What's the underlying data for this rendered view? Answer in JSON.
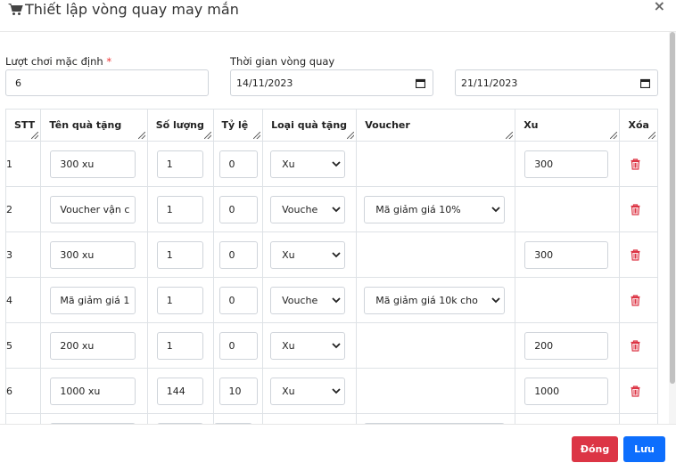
{
  "dialog": {
    "title": "Thiết lập vòng quay may mắn",
    "close_symbol": "×",
    "title_icon": "shopping-cart-icon"
  },
  "form": {
    "plays_label": "Lượt chơi mặc định",
    "plays_required_mark": "*",
    "plays_value": "6",
    "time_label": "Thời gian vòng quay",
    "start_date": "14/11/2023",
    "end_date": "21/11/2023"
  },
  "table": {
    "headers": [
      "STT",
      "Tên quà tặng",
      "Số lượng",
      "Tỷ lệ",
      "Loại quà tặng",
      "Voucher",
      "Xu",
      "Xóa"
    ],
    "rows": [
      {
        "stt": "1",
        "name": "300 xu",
        "qty": "1",
        "rate": "0",
        "type": "Xu",
        "voucher": "",
        "xu": "300"
      },
      {
        "stt": "2",
        "name": "Voucher vận c",
        "qty": "1",
        "rate": "0",
        "type": "Vouche",
        "voucher": "Mã giảm giá 10%",
        "xu": ""
      },
      {
        "stt": "3",
        "name": "300 xu",
        "qty": "1",
        "rate": "0",
        "type": "Xu",
        "voucher": "",
        "xu": "300"
      },
      {
        "stt": "4",
        "name": "Mã giảm giá 1",
        "qty": "1",
        "rate": "0",
        "type": "Vouche",
        "voucher": "Mã giảm giá 10k cho",
        "xu": ""
      },
      {
        "stt": "5",
        "name": "200 xu",
        "qty": "1",
        "rate": "0",
        "type": "Xu",
        "voucher": "",
        "xu": "200"
      },
      {
        "stt": "6",
        "name": "1000 xu",
        "qty": "144",
        "rate": "10",
        "type": "Xu",
        "voucher": "",
        "xu": "1000"
      }
    ],
    "delete_icon": "trash-icon",
    "delete_color": "#dc3545"
  },
  "footer": {
    "close_label": "Đóng",
    "save_label": "Lưu",
    "close_color": "#dc3545",
    "save_color": "#0d6efd"
  }
}
